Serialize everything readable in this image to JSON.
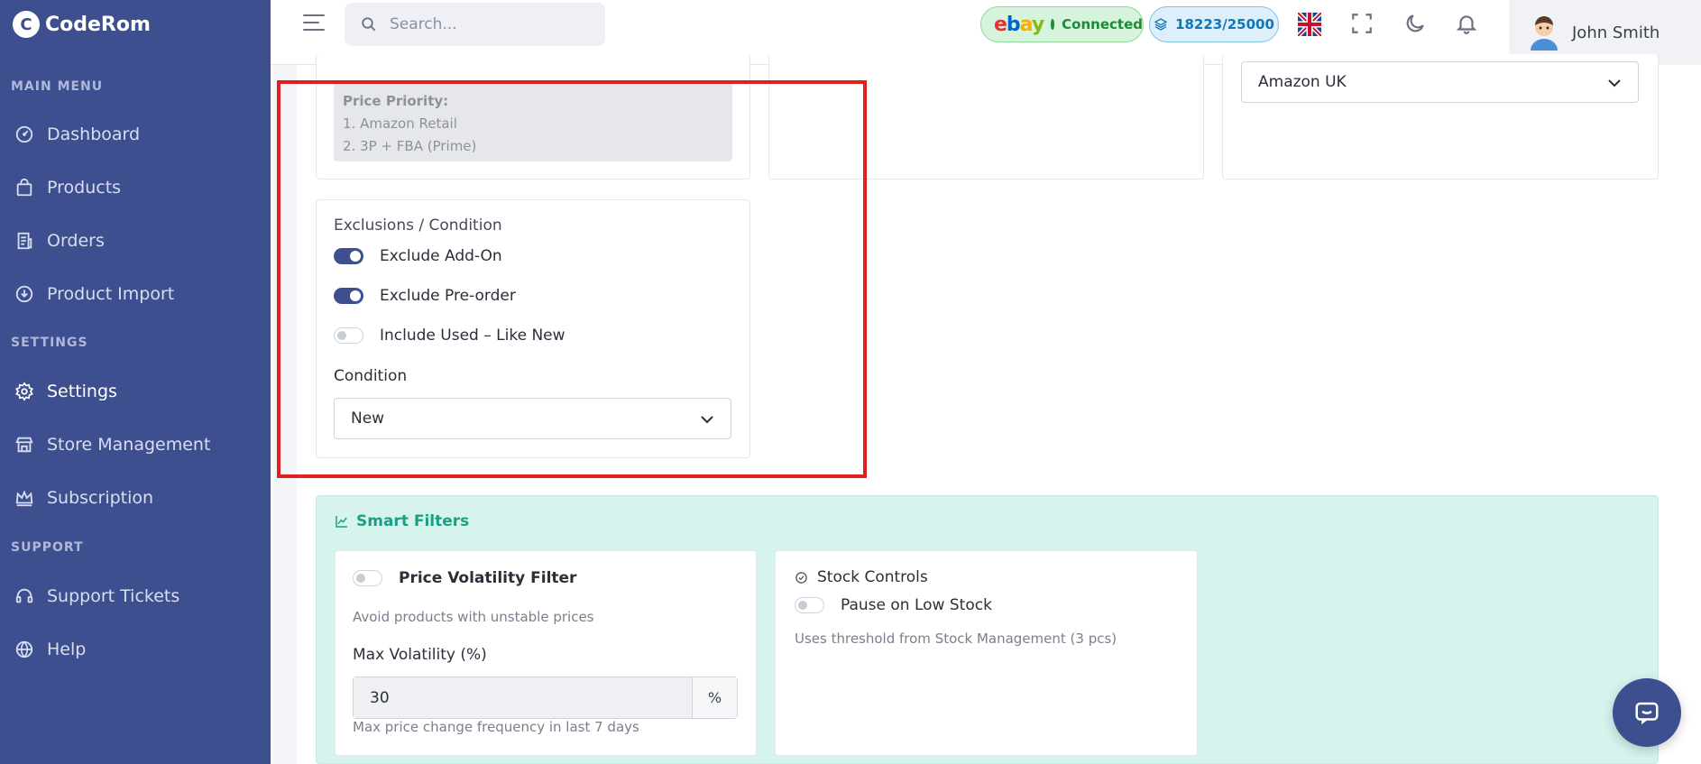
{
  "brand": {
    "name": "CodeRom",
    "logo_letter": "C"
  },
  "sidebar": {
    "sections": [
      {
        "label": "MAIN MENU"
      },
      {
        "label": "SETTINGS"
      },
      {
        "label": "SUPPORT"
      }
    ],
    "items": [
      {
        "label": "Dashboard",
        "icon": "dashboard-icon"
      },
      {
        "label": "Products",
        "icon": "bag-icon"
      },
      {
        "label": "Orders",
        "icon": "receipt-icon"
      },
      {
        "label": "Product Import",
        "icon": "download-icon"
      },
      {
        "label": "Settings",
        "icon": "gear-icon",
        "active": true
      },
      {
        "label": "Store Management",
        "icon": "store-icon"
      },
      {
        "label": "Subscription",
        "icon": "crown-icon"
      },
      {
        "label": "Support Tickets",
        "icon": "headset-icon"
      },
      {
        "label": "Help",
        "icon": "globe-icon"
      }
    ]
  },
  "header": {
    "search_placeholder": "Search...",
    "ebay": {
      "logo": [
        "e",
        "b",
        "a",
        "y"
      ],
      "status": "Connected"
    },
    "credits": "18223/25000",
    "user_name": "John Smith"
  },
  "price_priority": {
    "title": "Price Priority:",
    "items": [
      "1. Amazon Retail",
      "2. 3P + FBA (Prime)"
    ]
  },
  "marketplace_select": {
    "value": "Amazon UK"
  },
  "exclusions": {
    "title": "Exclusions / Condition",
    "toggles": [
      {
        "label": "Exclude Add-On",
        "on": true
      },
      {
        "label": "Exclude Pre-order",
        "on": true
      },
      {
        "label": "Include Used – Like New",
        "on": false
      }
    ],
    "condition_label": "Condition",
    "condition_value": "New"
  },
  "smart_filters": {
    "title": "Smart Filters",
    "volatility": {
      "label": "Price Volatility Filter",
      "on": false,
      "description": "Avoid products with unstable prices",
      "max_label": "Max Volatility (%)",
      "max_value": "30",
      "unit": "%",
      "hint": "Max price change frequency in last 7 days"
    },
    "stock": {
      "title": "Stock Controls",
      "toggle_label": "Pause on Low Stock",
      "on": false,
      "description": "Uses threshold from Stock Management (3 pcs)"
    }
  },
  "colors": {
    "sidebar": "#3e4f8f",
    "accent": "#3e4f8f",
    "smart_filters_bg": "#d7f3ee",
    "highlight": "#e0201f"
  }
}
